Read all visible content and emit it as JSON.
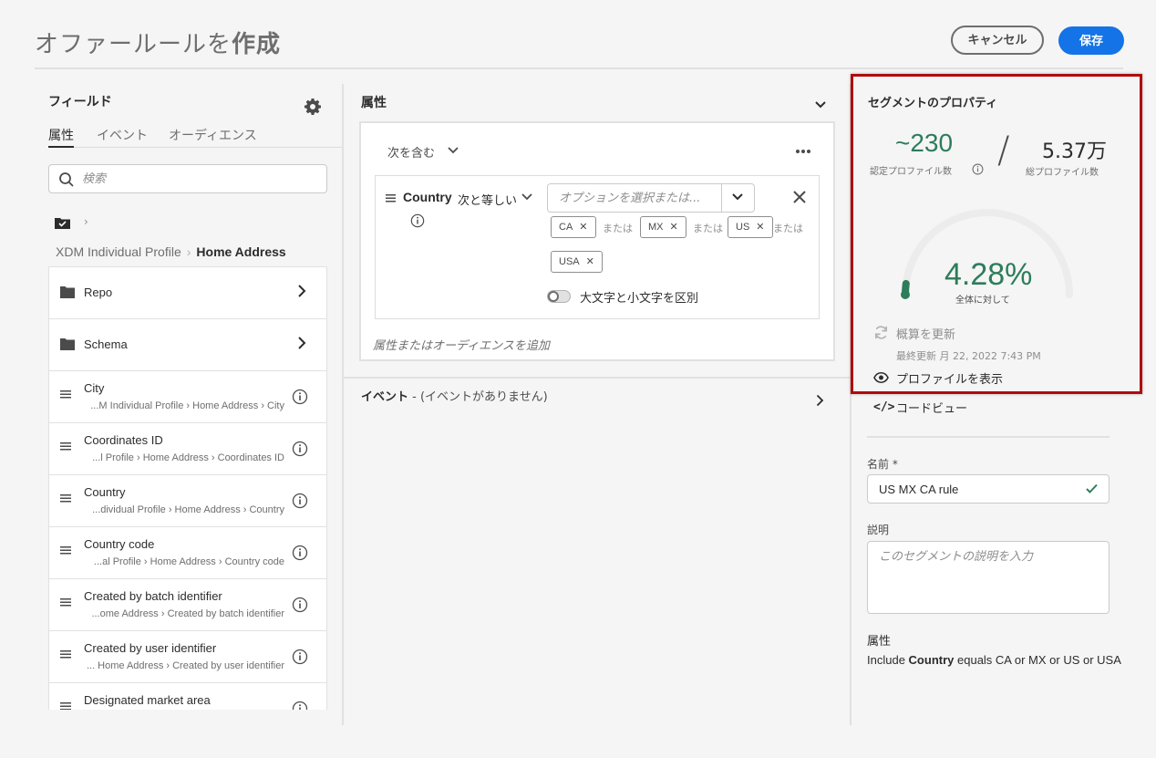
{
  "header": {
    "title_prefix": "オファールールを",
    "title_bold": "作成",
    "cancel_label": "キャンセル",
    "save_label": "保存"
  },
  "fields_panel": {
    "title": "フィールド",
    "tabs": [
      {
        "label": "属性",
        "active": true
      },
      {
        "label": "イベント",
        "active": false
      },
      {
        "label": "オーディエンス",
        "active": false
      }
    ],
    "search_placeholder": "検索",
    "path": {
      "root": "XDM Individual Profile",
      "current": "Home Address"
    },
    "items": [
      {
        "type": "folder",
        "title": "Repo"
      },
      {
        "type": "folder",
        "title": "Schema"
      },
      {
        "type": "field",
        "title": "City",
        "path": "...M Individual Profile › Home Address › City"
      },
      {
        "type": "field",
        "title": "Coordinates ID",
        "path": "...l Profile › Home Address › Coordinates ID"
      },
      {
        "type": "field",
        "title": "Country",
        "path": "...dividual Profile › Home Address › Country"
      },
      {
        "type": "field",
        "title": "Country code",
        "path": "...al Profile › Home Address › Country code"
      },
      {
        "type": "field",
        "title": "Created by batch identifier",
        "path": "...ome Address › Created by batch identifier"
      },
      {
        "type": "field",
        "title": "Created by user identifier",
        "path": "... Home Address › Created by user identifier"
      },
      {
        "type": "field",
        "title": "Designated market area",
        "path": ""
      }
    ]
  },
  "builder": {
    "attributes_title": "属性",
    "includes_label": "次を含む",
    "rule": {
      "field": "Country",
      "operator": "次と等しい",
      "options_placeholder": "オプションを選択または...",
      "values": [
        "CA",
        "MX",
        "US",
        "USA"
      ],
      "or_label": "または",
      "case_sensitive_label": "大文字と小文字を区別"
    },
    "add_placeholder": "属性またはオーディエンスを追加",
    "events_title": "イベント",
    "events_sub": " - (イベントがありません)"
  },
  "segment_properties": {
    "title": "セグメントのプロパティ",
    "qualified_value": "~230",
    "qualified_label": "認定プロファイル数",
    "slash": "/",
    "total_value": "5.37万",
    "total_label": "総プロファイル数",
    "percent": 4.28,
    "percent_text": "4.28%",
    "percent_label": "全体に対して",
    "refresh_label": "概算を更新",
    "last_updated": "最終更新 月 22, 2022 7:43 PM",
    "view_profiles_label": "プロファイルを表示",
    "code_view_label": "コードビュー",
    "accent_color": "#2d7d5a"
  },
  "form": {
    "name_label": "名前 *",
    "name_value": "US MX CA rule",
    "description_label": "説明",
    "description_placeholder": "このセグメントの説明を入力",
    "attributes_label": "属性",
    "summary_prefix": "Include ",
    "summary_field": "Country",
    "summary_rest": " equals CA or MX or US or USA"
  }
}
